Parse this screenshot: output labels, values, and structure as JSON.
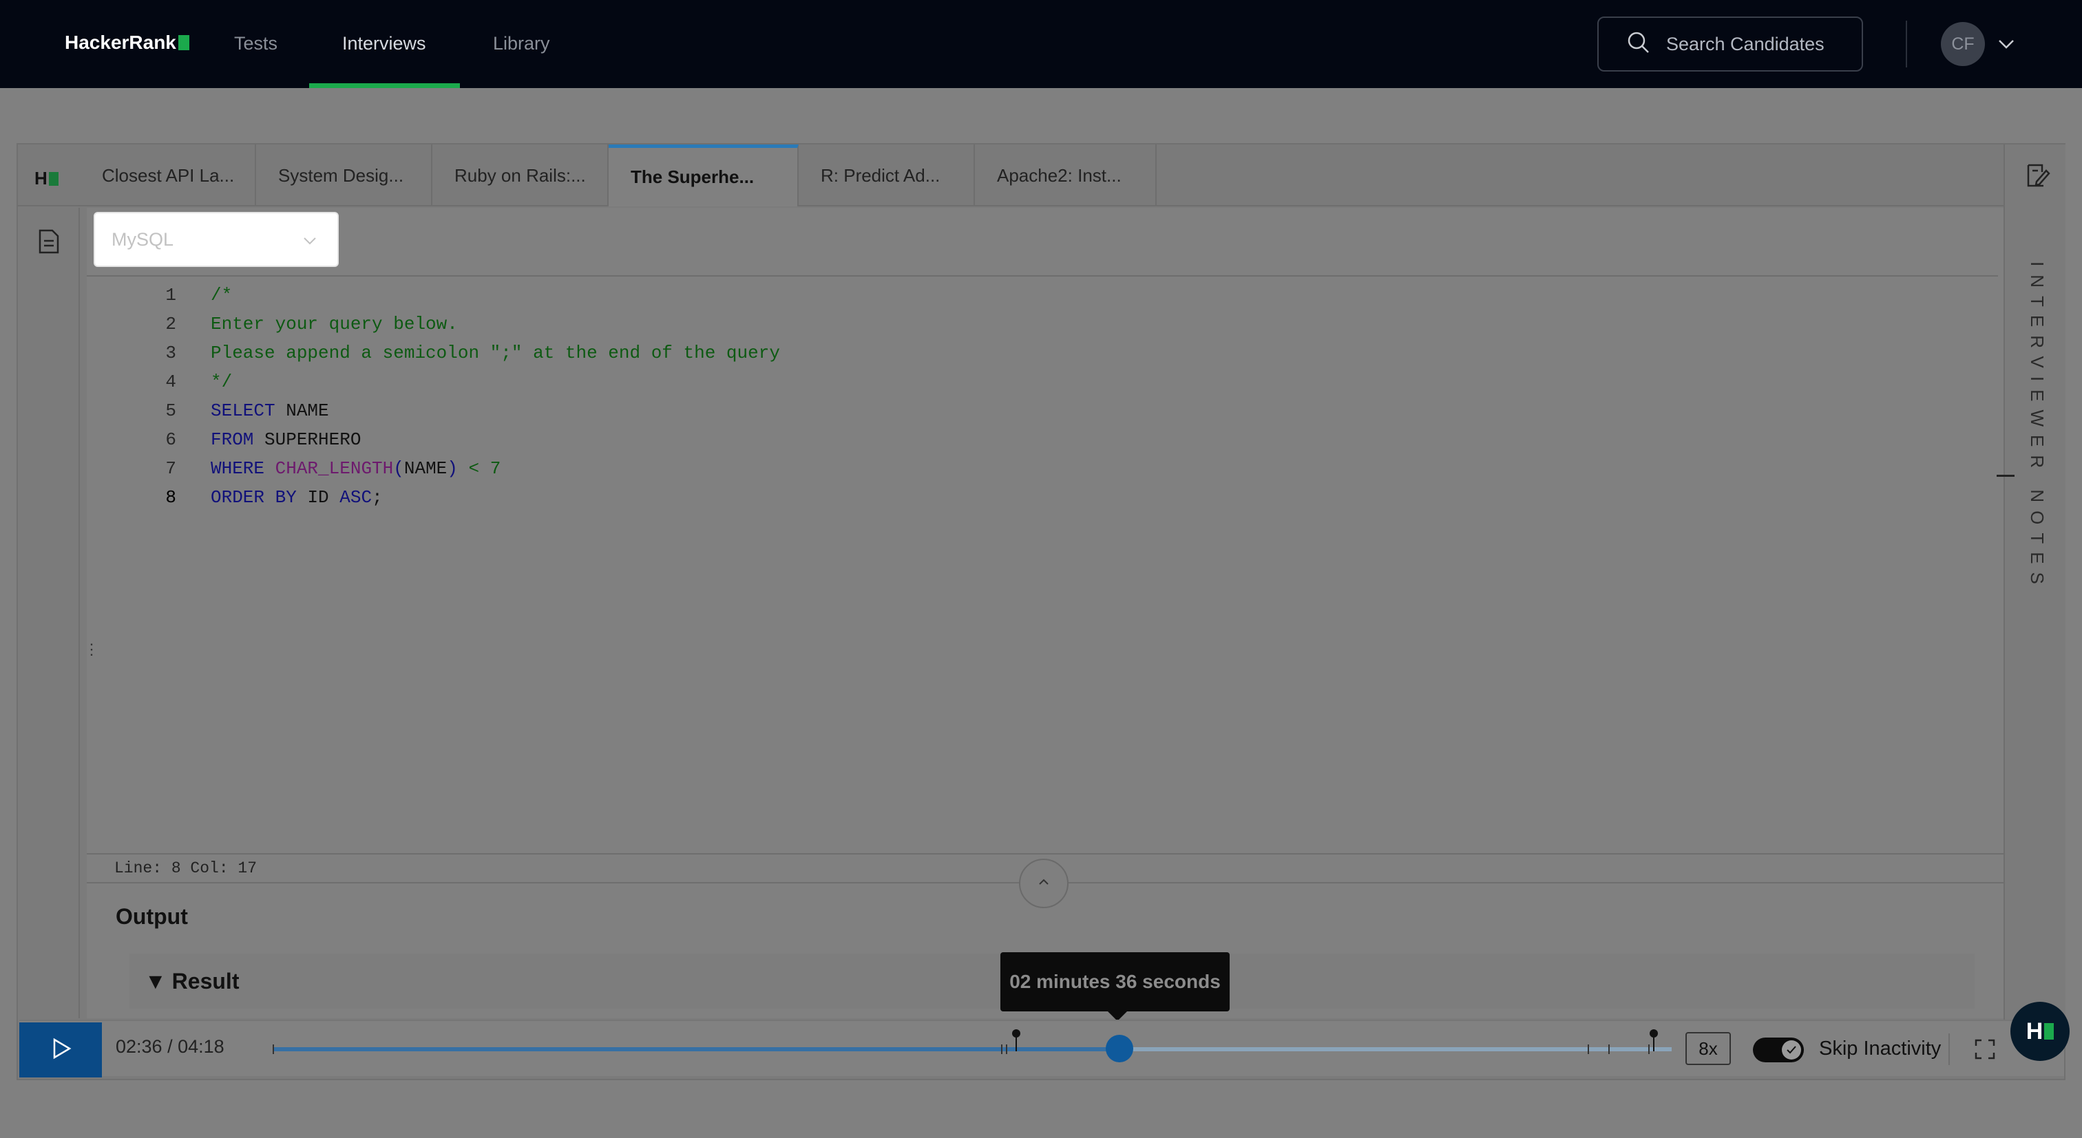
{
  "nav": {
    "logo": "HackerRank",
    "links": [
      "Tests",
      "Interviews",
      "Library"
    ],
    "active_link": "Interviews",
    "search_placeholder": "Search Candidates",
    "avatar_initials": "CF"
  },
  "tabs": [
    "Closest API La...",
    "System Desig...",
    "Ruby on Rails:...",
    "The Superhe...",
    "R: Predict Ad...",
    "Apache2: Inst..."
  ],
  "active_tab": "The Superhe...",
  "hr_mini": "H",
  "editor": {
    "language": "MySQL",
    "lines": [
      {
        "num": "1",
        "parts": [
          {
            "t": "/*",
            "c": "c-comment"
          }
        ]
      },
      {
        "num": "2",
        "parts": [
          {
            "t": "Enter your query below.",
            "c": "c-comment"
          }
        ]
      },
      {
        "num": "3",
        "parts": [
          {
            "t": "Please append a semicolon \";\" at the end of the query",
            "c": "c-comment"
          }
        ]
      },
      {
        "num": "4",
        "parts": [
          {
            "t": "*/",
            "c": "c-comment"
          }
        ]
      },
      {
        "num": "5",
        "parts": [
          {
            "t": "SELECT",
            "c": "c-kw"
          },
          {
            "t": " NAME",
            "c": "c-plain"
          }
        ]
      },
      {
        "num": "6",
        "parts": [
          {
            "t": "FROM",
            "c": "c-kw"
          },
          {
            "t": " SUPERHERO",
            "c": "c-plain"
          }
        ]
      },
      {
        "num": "7",
        "parts": [
          {
            "t": "WHERE",
            "c": "c-kw"
          },
          {
            "t": " ",
            "c": "c-plain"
          },
          {
            "t": "CHAR_LENGTH",
            "c": "c-fn"
          },
          {
            "t": "(",
            "c": "c-kw"
          },
          {
            "t": "NAME",
            "c": "c-plain"
          },
          {
            "t": ")",
            "c": "c-kw"
          },
          {
            "t": " < 7",
            "c": "c-num"
          }
        ]
      },
      {
        "num": "8",
        "parts": [
          {
            "t": "ORDER",
            "c": "c-kw"
          },
          {
            "t": " ",
            "c": "c-plain"
          },
          {
            "t": "BY",
            "c": "c-kw"
          },
          {
            "t": " ID ",
            "c": "c-plain"
          },
          {
            "t": "ASC",
            "c": "c-kw"
          },
          {
            "t": ";",
            "c": "c-plain"
          }
        ]
      }
    ],
    "status": "Line: 8 Col: 17"
  },
  "right_rail": {
    "label": "INTERVIEWER NOTES"
  },
  "output": {
    "title": "Output",
    "result_label": "Result",
    "result_arrow": "▼"
  },
  "player": {
    "time": "02:36 / 04:18",
    "progress_fraction": 0.6047,
    "tooltip": "02 minutes 36 seconds",
    "speed": "8x",
    "skip_label": "Skip Inactivity",
    "skip_on": true
  },
  "colors": {
    "accent_green": "#1ba94c",
    "player_blue": "#0a4a86",
    "nav_bg": "#030712"
  }
}
